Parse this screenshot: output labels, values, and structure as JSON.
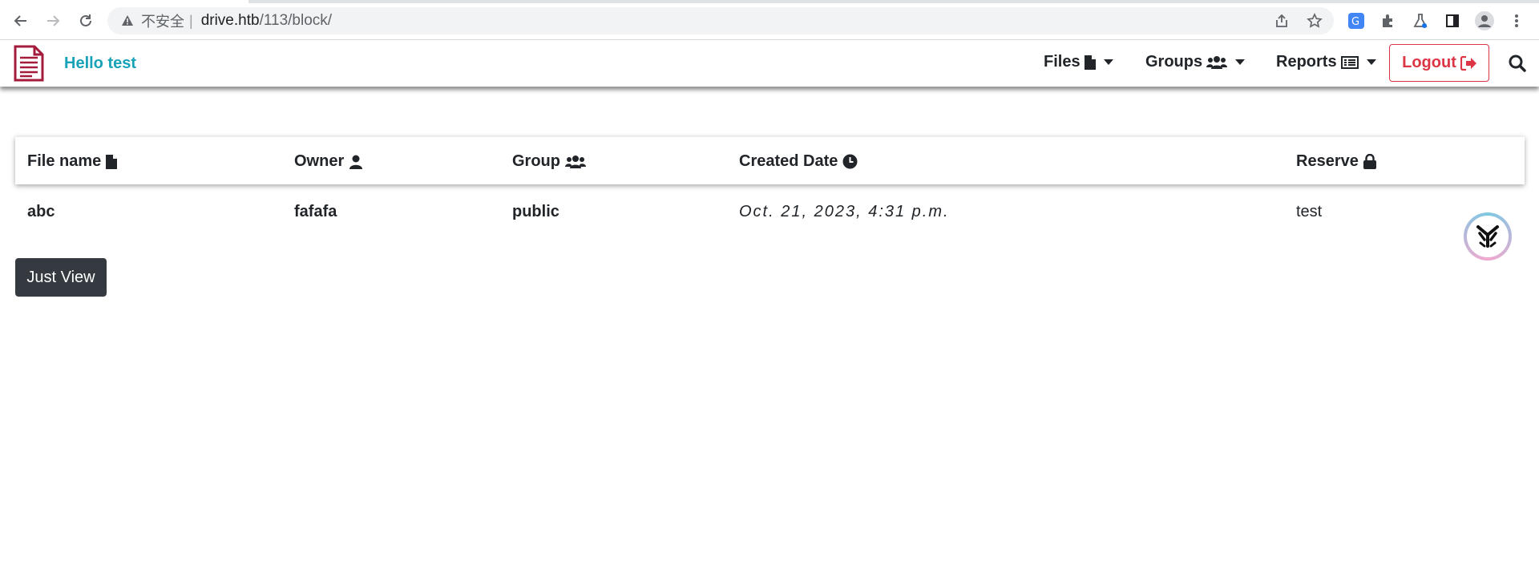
{
  "browser": {
    "security_label": "不安全",
    "separator": "|",
    "url_host": "drive.htb",
    "url_path": "/113/block/"
  },
  "navbar": {
    "brand_text": "Hello test",
    "items": [
      {
        "label": "Files",
        "icon": "file-icon"
      },
      {
        "label": "Groups",
        "icon": "users-icon"
      },
      {
        "label": "Reports",
        "icon": "list-alt-icon"
      }
    ],
    "logout_label": "Logout",
    "colors": {
      "brand": "#17a2b8",
      "logout": "#dc3545",
      "logo": "#a51b3c"
    }
  },
  "table": {
    "headers": [
      {
        "label": "File name",
        "icon": "file-icon"
      },
      {
        "label": "Owner",
        "icon": "user-icon"
      },
      {
        "label": "Group",
        "icon": "users-icon"
      },
      {
        "label": "Created Date",
        "icon": "clock-icon"
      },
      {
        "label": "Reserve",
        "icon": "lock-icon"
      }
    ],
    "rows": [
      {
        "file_name": "abc",
        "owner": "fafafa",
        "group": "public",
        "created_date": "Oct. 21, 2023, 4:31 p.m.",
        "reserve": "test"
      }
    ]
  },
  "actions": {
    "just_view_label": "Just View"
  }
}
